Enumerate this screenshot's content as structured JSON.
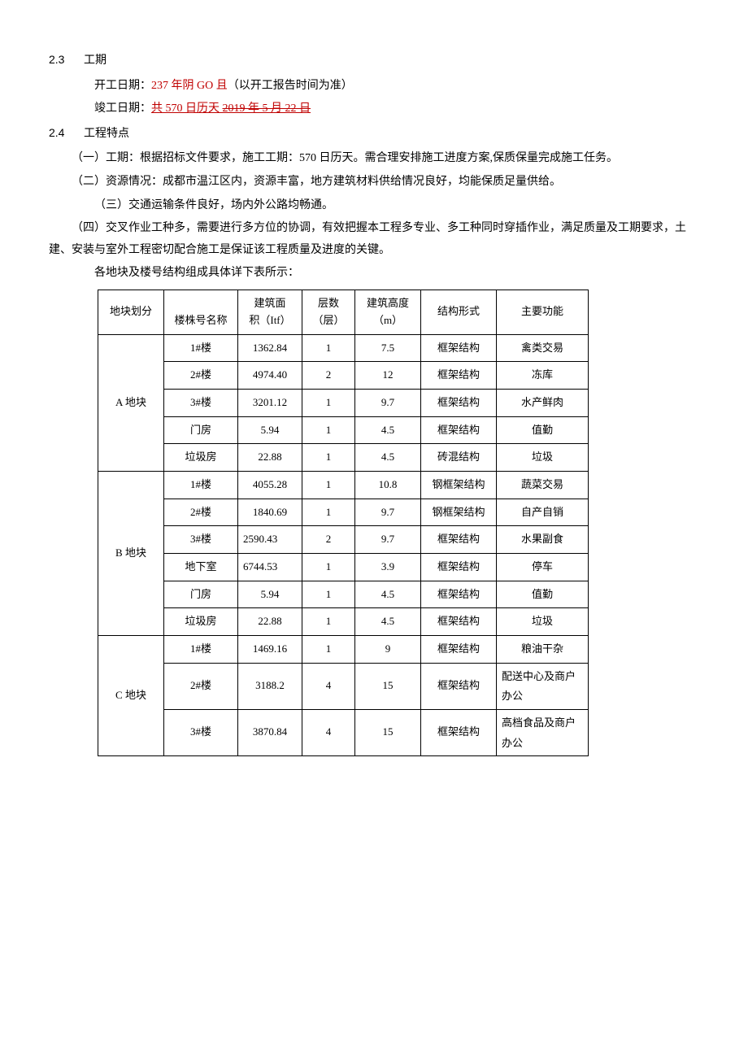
{
  "sec23": {
    "num": "2.3",
    "title": "工期",
    "start_label": "开工日期：",
    "start_red": "237 年阴 GO 且",
    "start_suffix": "（以开工报告时间为准）",
    "end_label": "竣工日期：",
    "end_part1": "共 570 日历天 ",
    "end_part2": "2019 年 5 月 22 日"
  },
  "sec24": {
    "num": "2.4",
    "title": "工程特点",
    "p1": "（一）工期：根据招标文件要求，施工工期：570 日历天。需合理安排施工进度方案,保质保量完成施工任务。",
    "p2": "（二）资源情况：成都市温江区内，资源丰富，地方建筑材料供给情况良好，均能保质足量供给。",
    "p3": "（三）交通运输条件良好，场内外公路均畅通。",
    "p4": "（四）交叉作业工种多，需要进行多方位的协调，有效把握本工程多专业、多工种同时穿插作业，满足质量及工期要求，土建、安装与室外工程密切配合施工是保证该工程质量及进度的关键。",
    "p5": "各地块及楼号结构组成具体详下表所示："
  },
  "table": {
    "headers": {
      "block": "地块划分",
      "name": "楼株号名称",
      "area_l1": "建筑面",
      "area_l2": "积（Itf）",
      "floors_l1": "层数",
      "floors_l2": "（层）",
      "height_l1": "建筑高度",
      "height_l2": "（m）",
      "struct": "结构形式",
      "func": "主要功能"
    },
    "blockA": {
      "label": "A 地块",
      "rows": [
        {
          "name": "1#楼",
          "area": "1362.84",
          "floors": "1",
          "height": "7.5",
          "struct": "框架结构",
          "func": "禽类交易"
        },
        {
          "name": "2#楼",
          "area": "4974.40",
          "floors": "2",
          "height": "12",
          "struct": "框架结构",
          "func": "冻库"
        },
        {
          "name": "3#楼",
          "area": "3201.12",
          "floors": "1",
          "height": "9.7",
          "struct": "框架结构",
          "func": "水产鲜肉"
        },
        {
          "name": "门房",
          "area": "5.94",
          "floors": "1",
          "height": "4.5",
          "struct": "框架结构",
          "func": "值勤"
        },
        {
          "name": "垃圾房",
          "area": "22.88",
          "floors": "1",
          "height": "4.5",
          "struct": "砖混结构",
          "func": "垃圾"
        }
      ]
    },
    "blockB": {
      "label": "B 地块",
      "rows": [
        {
          "name": "1#楼",
          "area": "4055.28",
          "floors": "1",
          "height": "10.8",
          "struct": "钢框架结构",
          "func": "蔬菜交易"
        },
        {
          "name": "2#楼",
          "area": "1840.69",
          "floors": "1",
          "height": "9.7",
          "struct": "钢框架结构",
          "func": "自产自销"
        },
        {
          "name": "3#楼",
          "area": "2590.43",
          "floors": "2",
          "height": "9.7",
          "struct": "框架结构",
          "func": "水果副食"
        },
        {
          "name": "地下室",
          "area": "6744.53",
          "floors": "1",
          "height": "3.9",
          "struct": "框架结构",
          "func": "停车"
        },
        {
          "name": "门房",
          "area": "5.94",
          "floors": "1",
          "height": "4.5",
          "struct": "框架结构",
          "func": "值勤"
        },
        {
          "name": "垃圾房",
          "area": "22.88",
          "floors": "1",
          "height": "4.5",
          "struct": "框架结构",
          "func": "垃圾"
        }
      ]
    },
    "blockC": {
      "label": "C 地块",
      "rows": [
        {
          "name": "1#楼",
          "area": "1469.16",
          "floors": "1",
          "height": "9",
          "struct": "框架结构",
          "func": "粮油干杂"
        },
        {
          "name": "2#楼",
          "area": "3188.2",
          "floors": "4",
          "height": "15",
          "struct": "框架结构",
          "func": "配送中心及商户办公"
        },
        {
          "name": "3#楼",
          "area": "3870.84",
          "floors": "4",
          "height": "15",
          "struct": "框架结构",
          "func": "高档食品及商户办公"
        }
      ]
    }
  }
}
